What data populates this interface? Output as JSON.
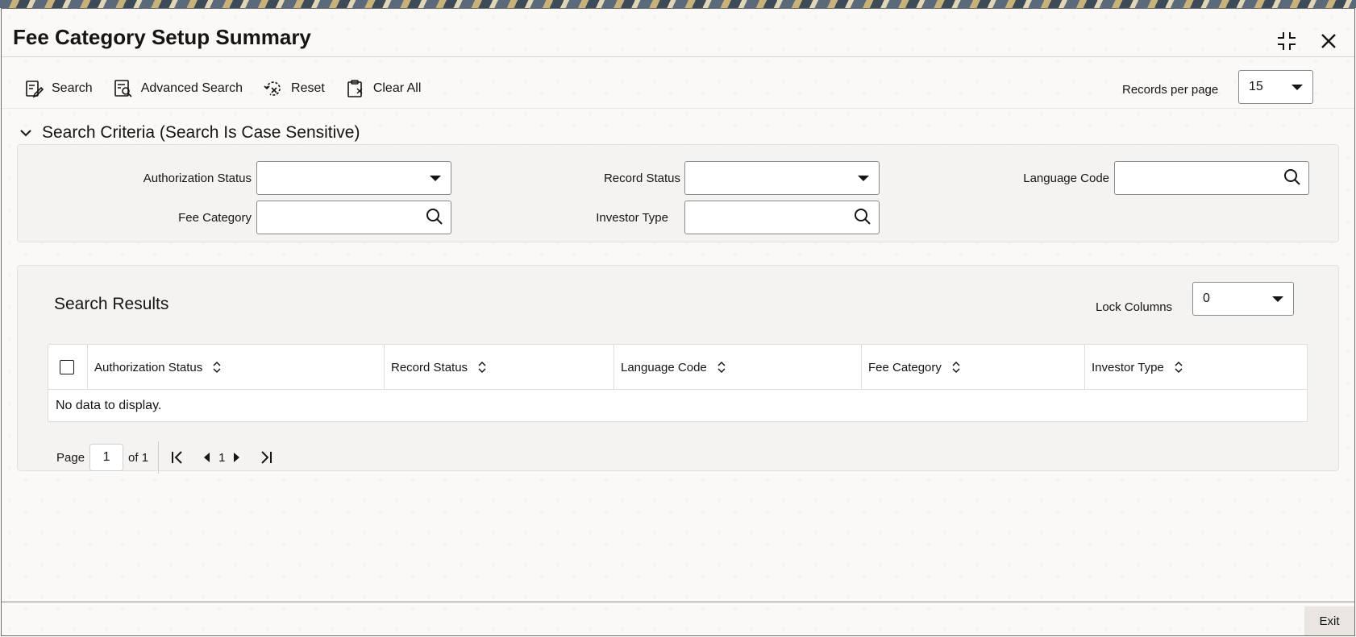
{
  "window": {
    "title": "Fee Category Setup Summary"
  },
  "toolbar": {
    "search": "Search",
    "advanced_search": "Advanced Search",
    "reset": "Reset",
    "clear_all": "Clear All"
  },
  "records_per_page": {
    "label": "Records per page",
    "value": "15"
  },
  "search_criteria": {
    "heading": "Search Criteria (Search Is Case Sensitive)",
    "fields": {
      "authorization_status": {
        "label": "Authorization Status",
        "value": ""
      },
      "record_status": {
        "label": "Record Status",
        "value": ""
      },
      "language_code": {
        "label": "Language Code",
        "value": ""
      },
      "fee_category": {
        "label": "Fee Category",
        "value": ""
      },
      "investor_type": {
        "label": "Investor Type",
        "value": ""
      }
    }
  },
  "results": {
    "title": "Search Results",
    "lock_columns": {
      "label": "Lock Columns",
      "value": "0"
    },
    "columns": [
      "Authorization Status",
      "Record Status",
      "Language Code",
      "Fee Category",
      "Investor Type"
    ],
    "rows": [],
    "empty_message": "No data to display."
  },
  "pager": {
    "page_label": "Page",
    "page_value": "1",
    "of_label": "of 1",
    "current": "1"
  },
  "footer": {
    "exit": "Exit"
  }
}
